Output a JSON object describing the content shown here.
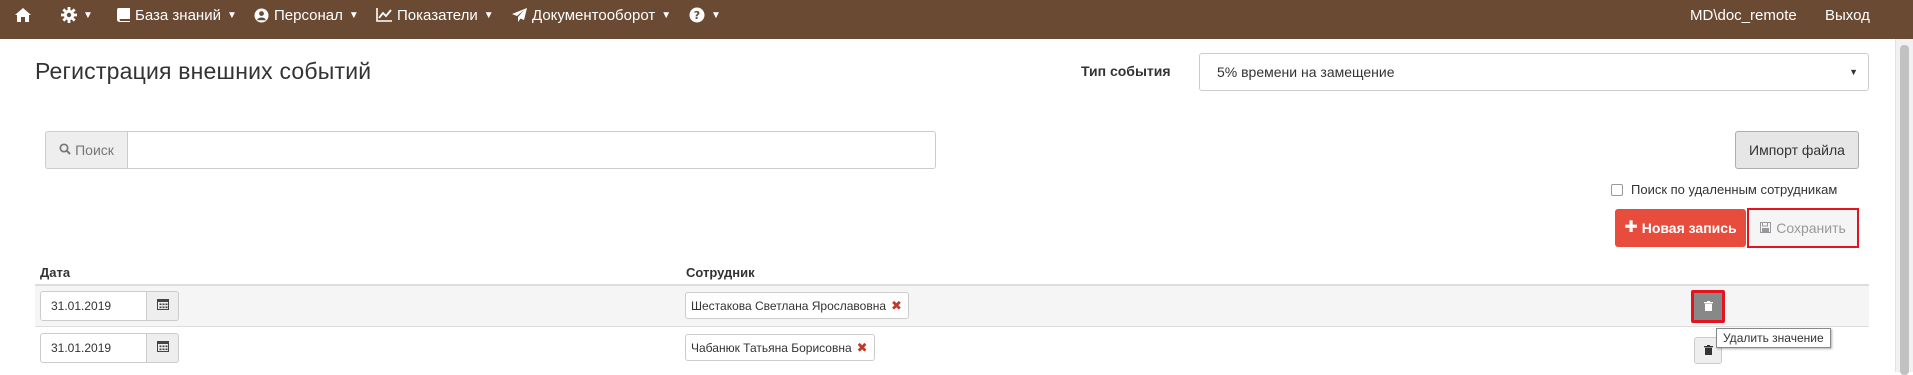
{
  "navbar": {
    "items": [
      {
        "label": "",
        "icon": "home-icon",
        "has_caret": false
      },
      {
        "label": "",
        "icon": "gear-icon",
        "has_caret": true
      },
      {
        "label": "База знаний",
        "icon": "book-icon",
        "has_caret": true
      },
      {
        "label": "Персонал",
        "icon": "user-circle-icon",
        "has_caret": true
      },
      {
        "label": "Показатели",
        "icon": "line-chart-icon",
        "has_caret": true
      },
      {
        "label": "Документооборот",
        "icon": "paper-plane-icon",
        "has_caret": true
      },
      {
        "label": "",
        "icon": "question-circle-icon",
        "has_caret": true
      }
    ],
    "user": "MD\\doc_remote",
    "logout": "Выход",
    "background_color": "#6b4a33"
  },
  "page": {
    "title": "Регистрация внешних событий",
    "event_type_label": "Тип события",
    "event_type_value": "5% времени на замещение"
  },
  "search": {
    "addon_label": "Поиск",
    "value": ""
  },
  "toolbar": {
    "import_label": "Импорт файла",
    "deleted_employees_label": "Поиск по удаленным сотрудникам",
    "deleted_employees_checked": false,
    "new_record_label": "Новая запись",
    "save_label": "Сохранить"
  },
  "table": {
    "headers": {
      "date": "Дата",
      "employee": "Сотрудник"
    },
    "rows": [
      {
        "date": "31.01.2019",
        "employee": "Шестакова Светлана Ярославовна"
      },
      {
        "date": "31.01.2019",
        "employee": "Чабанюк Татьяна Борисовна"
      }
    ]
  },
  "tooltip": {
    "text": "Удалить значение"
  },
  "colors": {
    "accent_red": "#e74c3c",
    "highlight_outline": "#e3141f"
  }
}
